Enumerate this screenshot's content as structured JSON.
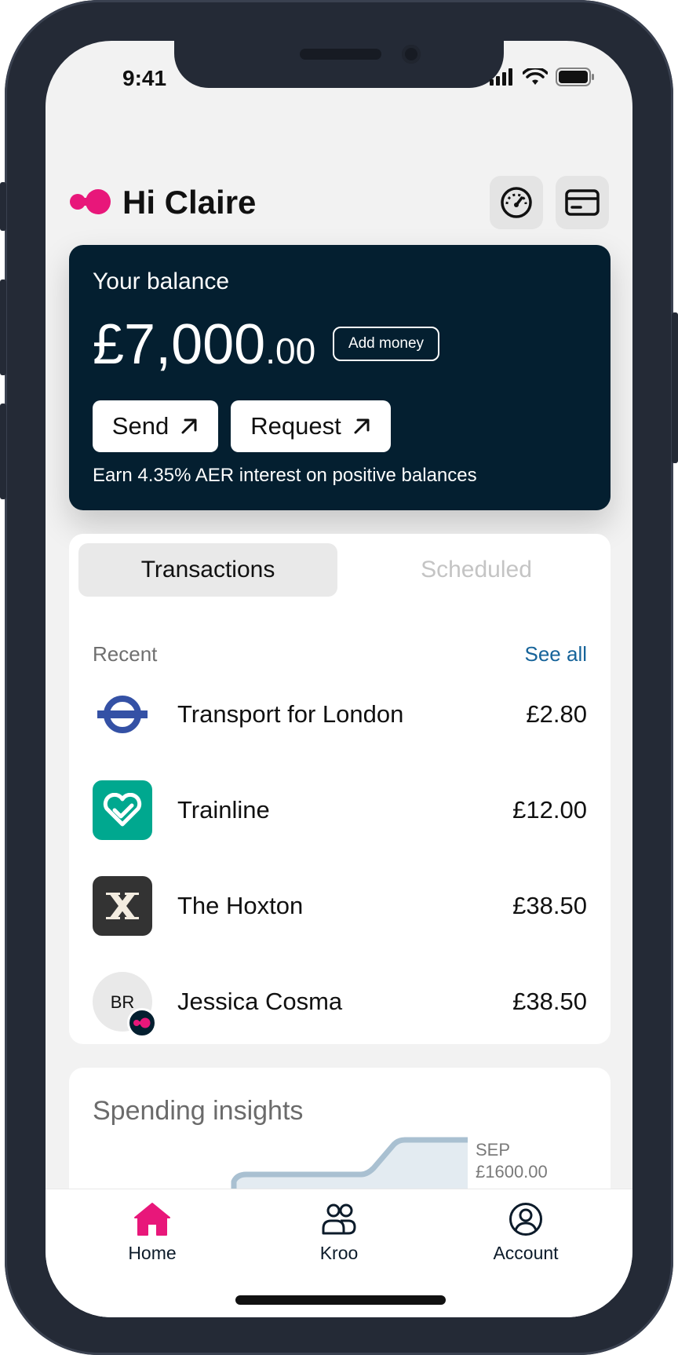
{
  "status_bar": {
    "time": "9:41"
  },
  "header": {
    "greeting": "Hi Claire"
  },
  "balance": {
    "label": "Your balance",
    "amount_main": "£7,000",
    "amount_cents": ".00",
    "add_money_label": "Add money",
    "send_label": "Send",
    "request_label": "Request",
    "note": "Earn 4.35% AER interest on positive balances"
  },
  "transactions": {
    "tabs": [
      {
        "label": "Transactions",
        "active": true
      },
      {
        "label": "Scheduled",
        "active": false
      }
    ],
    "section_label": "Recent",
    "see_all_label": "See all",
    "items": [
      {
        "name": "Transport for London",
        "amount": "£2.80",
        "icon": "roundel-icon"
      },
      {
        "name": "Trainline",
        "amount": "£12.00",
        "icon": "trainline-logo-icon"
      },
      {
        "name": "The Hoxton",
        "amount": "£38.50",
        "icon": "hoxton-logo-icon"
      },
      {
        "name": "Jessica Cosma",
        "amount": "£38.50",
        "icon": "avatar",
        "initials": "BR"
      }
    ]
  },
  "insights": {
    "title": "Spending insights",
    "month": "SEP",
    "value": "£1600.00"
  },
  "nav": {
    "items": [
      {
        "label": "Home",
        "icon": "home-icon",
        "active": true
      },
      {
        "label": "Kroo",
        "icon": "people-icon",
        "active": false
      },
      {
        "label": "Account",
        "icon": "account-icon",
        "active": false
      }
    ]
  },
  "colors": {
    "brand_pink": "#e8177a",
    "card_navy": "#041f30",
    "link_blue": "#17649a",
    "trainline_green": "#00a88f",
    "hoxton_dark": "#333333",
    "tfl_blue": "#3451a5"
  }
}
